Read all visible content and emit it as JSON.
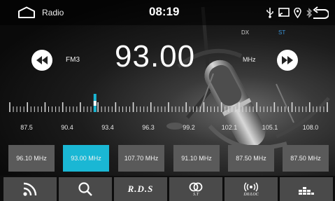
{
  "statusbar": {
    "title": "Radio",
    "time": "08:19",
    "icons": [
      "home-icon",
      "usb-icon",
      "screen-mirror-icon",
      "location-icon",
      "bluetooth-icon",
      "back-icon"
    ]
  },
  "indicators": {
    "dx": "DX",
    "st": "ST",
    "st_color": "#3a93d6"
  },
  "tuner": {
    "band": "FM3",
    "frequency": "93.00",
    "unit": "MHz",
    "prev_icon": "seek-back-icon",
    "next_icon": "seek-forward-icon"
  },
  "dial": {
    "labels": [
      "87.5",
      "90.4",
      "93.4",
      "96.3",
      "99.2",
      "102.1",
      "105.1",
      "108.0"
    ],
    "min": 87.5,
    "max": 108.0,
    "current": 93.0,
    "marker_color": "#1ab7d4"
  },
  "presets": [
    {
      "label": "96.10  MHz",
      "active": false
    },
    {
      "label": "93.00  MHz",
      "active": true
    },
    {
      "label": "107.70  MHz",
      "active": false
    },
    {
      "label": "91.10  MHz",
      "active": false
    },
    {
      "label": "87.50  MHz",
      "active": false
    },
    {
      "label": "87.50  MHz",
      "active": false
    }
  ],
  "toolbar": {
    "rds_label": "R.D.S",
    "st_label": "S.T",
    "dxloc_label": "DX/LOC",
    "icons": [
      "radio-feed-icon",
      "search-icon",
      "rds-icon",
      "stereo-icon",
      "dx-loc-icon",
      "equalizer-icon"
    ]
  },
  "colors": {
    "accent": "#1ab7d4",
    "preset_bg": "#5a5a5a",
    "toolbar_bg": "#4a4a4a"
  }
}
